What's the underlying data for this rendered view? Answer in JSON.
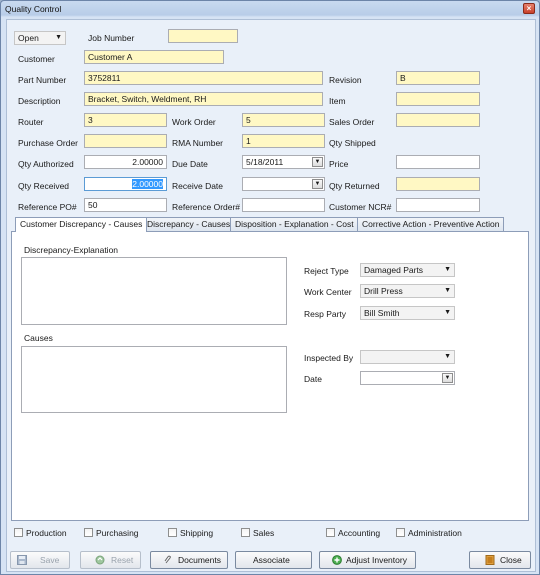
{
  "window": {
    "title": "Quality Control",
    "close": "×"
  },
  "status_select": {
    "value": "Open"
  },
  "fields": {
    "job_number": {
      "label": "Job Number",
      "value": ""
    },
    "customer": {
      "label": "Customer",
      "value": "Customer A"
    },
    "part_number": {
      "label": "Part Number",
      "value": "3752811"
    },
    "revision": {
      "label": "Revision",
      "value": "B"
    },
    "description": {
      "label": "Description",
      "value": "Bracket, Switch, Weldment, RH"
    },
    "item": {
      "label": "Item",
      "value": ""
    },
    "router": {
      "label": "Router",
      "value": "3"
    },
    "work_order": {
      "label": "Work Order",
      "value": "5"
    },
    "sales_order": {
      "label": "Sales Order",
      "value": ""
    },
    "purchase_order": {
      "label": "Purchase Order",
      "value": ""
    },
    "rma_number": {
      "label": "RMA Number",
      "value": "1"
    },
    "qty_shipped": {
      "label": "Qty Shipped",
      "value": ""
    },
    "qty_authorized": {
      "label": "Qty Authorized",
      "value": "2.00000"
    },
    "due_date": {
      "label": "Due Date",
      "value": "5/18/2011"
    },
    "price": {
      "label": "Price",
      "value": ""
    },
    "qty_received": {
      "label": "Qty Received",
      "value_prefix": "",
      "value_selected": "2.00000"
    },
    "receive_date": {
      "label": "Receive Date",
      "value": ""
    },
    "qty_returned": {
      "label": "Qty Returned",
      "value": ""
    },
    "reference_po": {
      "label": "Reference PO#",
      "value": "50"
    },
    "reference_order": {
      "label": "Reference Order#",
      "value": ""
    },
    "customer_ncr": {
      "label": "Customer NCR#",
      "value": ""
    }
  },
  "tabs": [
    {
      "label": "Customer Discrepancy - Causes"
    },
    {
      "label": "Discrepancy - Causes"
    },
    {
      "label": "Disposition - Explanation - Cost"
    },
    {
      "label": "Corrective Action - Preventive Action"
    }
  ],
  "panel": {
    "discrepancy_label": "Discrepancy-Explanation",
    "causes_label": "Causes",
    "reject_type": {
      "label": "Reject Type",
      "value": "Damaged Parts"
    },
    "work_center": {
      "label": "Work Center",
      "value": "Drill Press"
    },
    "resp_party": {
      "label": "Resp Party",
      "value": "Bill Smith"
    },
    "inspected_by": {
      "label": "Inspected By",
      "value": ""
    },
    "date": {
      "label": "Date",
      "value": ""
    }
  },
  "departments": [
    {
      "label": "Production",
      "checked": false
    },
    {
      "label": "Purchasing",
      "checked": false
    },
    {
      "label": "Shipping",
      "checked": false
    },
    {
      "label": "Sales",
      "checked": false
    },
    {
      "label": "Accounting",
      "checked": false
    },
    {
      "label": "Administration",
      "checked": false
    }
  ],
  "buttons": {
    "save": "Save",
    "reset": "Reset",
    "documents": "Documents",
    "associate": "Associate",
    "adjust_inventory": "Adjust Inventory",
    "close": "Close"
  },
  "icons": {
    "dropdown": "▼",
    "calendar": "▾"
  }
}
